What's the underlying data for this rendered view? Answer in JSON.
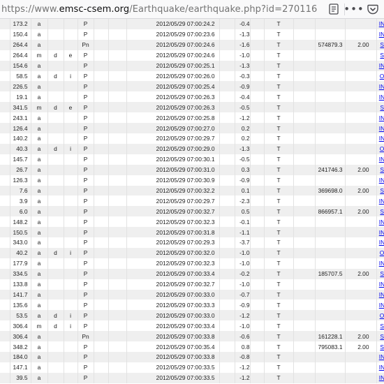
{
  "urlbar": {
    "url_prefix": "https://www.",
    "url_host": "emsc-csem.org",
    "url_path": "/Earthquake/earthquake.php?id=270116",
    "reader_icon": "reader-view-icon",
    "more_icon": "more-actions-icon",
    "pocket_icon": "pocket-icon",
    "more_glyph": "•••"
  },
  "table": {
    "rows": [
      {
        "dist": "173.2",
        "f1": "a",
        "f2": "",
        "f3": "",
        "phase": "P",
        "time": "2012/05/29 07:00:24.2",
        "res": "-0.4",
        "flag": "T",
        "amp": "",
        "period": "",
        "agency": "INGV"
      },
      {
        "dist": "150.4",
        "f1": "a",
        "f2": "",
        "f3": "",
        "phase": "P",
        "time": "2012/05/29 07:00:23.6",
        "res": "-1.3",
        "flag": "T",
        "amp": "",
        "period": "",
        "agency": "INGV"
      },
      {
        "dist": "264.4",
        "f1": "a",
        "f2": "",
        "f3": "",
        "phase": "Pn",
        "time": "2012/05/29 07:00:24.6",
        "res": "-1.6",
        "flag": "T",
        "amp": "574879.3",
        "period": "2.00",
        "agency": "SED"
      },
      {
        "dist": "264.4",
        "f1": "m",
        "f2": "d",
        "f3": "e",
        "phase": "P",
        "time": "2012/05/29 07:00:24.6",
        "res": "-1.0",
        "flag": "T",
        "amp": "",
        "period": "",
        "agency": "SED"
      },
      {
        "dist": "154.6",
        "f1": "a",
        "f2": "",
        "f3": "",
        "phase": "P",
        "time": "2012/05/29 07:00:25.1",
        "res": "-1.3",
        "flag": "T",
        "amp": "",
        "period": "",
        "agency": "INGV"
      },
      {
        "dist": "58.5",
        "f1": "a",
        "f2": "d",
        "f3": "i",
        "phase": "P",
        "time": "2012/05/29 07:00:26.0",
        "res": "-0.3",
        "flag": "T",
        "amp": "",
        "period": "",
        "agency": "OGS"
      },
      {
        "dist": "226.5",
        "f1": "a",
        "f2": "",
        "f3": "",
        "phase": "P",
        "time": "2012/05/29 07:00:25.4",
        "res": "-0.9",
        "flag": "T",
        "amp": "",
        "period": "",
        "agency": "INGV"
      },
      {
        "dist": "19.1",
        "f1": "a",
        "f2": "",
        "f3": "",
        "phase": "P",
        "time": "2012/05/29 07:00:26.3",
        "res": "-0.4",
        "flag": "T",
        "amp": "",
        "period": "",
        "agency": "INGV"
      },
      {
        "dist": "341.5",
        "f1": "m",
        "f2": "d",
        "f3": "e",
        "phase": "P",
        "time": "2012/05/29 07:00:26.3",
        "res": "-0.5",
        "flag": "T",
        "amp": "",
        "period": "",
        "agency": "SED"
      },
      {
        "dist": "243.1",
        "f1": "a",
        "f2": "",
        "f3": "",
        "phase": "P",
        "time": "2012/05/29 07:00:25.8",
        "res": "-1.2",
        "flag": "T",
        "amp": "",
        "period": "",
        "agency": "INGV"
      },
      {
        "dist": "126.4",
        "f1": "a",
        "f2": "",
        "f3": "",
        "phase": "P",
        "time": "2012/05/29 07:00:27.0",
        "res": "0.2",
        "flag": "T",
        "amp": "",
        "period": "",
        "agency": "INGV"
      },
      {
        "dist": "140.2",
        "f1": "a",
        "f2": "",
        "f3": "",
        "phase": "P",
        "time": "2012/05/29 07:00:29.7",
        "res": "0.2",
        "flag": "T",
        "amp": "",
        "period": "",
        "agency": "INGV"
      },
      {
        "dist": "40.3",
        "f1": "a",
        "f2": "d",
        "f3": "i",
        "phase": "P",
        "time": "2012/05/29 07:00:29.0",
        "res": "-1.3",
        "flag": "T",
        "amp": "",
        "period": "",
        "agency": "OGS"
      },
      {
        "dist": "145.7",
        "f1": "a",
        "f2": "",
        "f3": "",
        "phase": "P",
        "time": "2012/05/29 07:00:30.1",
        "res": "-0.5",
        "flag": "T",
        "amp": "",
        "period": "",
        "agency": "INGV"
      },
      {
        "dist": "26.7",
        "f1": "a",
        "f2": "",
        "f3": "",
        "phase": "P",
        "time": "2012/05/29 07:00:31.0",
        "res": "0.3",
        "flag": "T",
        "amp": "241746.3",
        "period": "2.00",
        "agency": "SED"
      },
      {
        "dist": "126.3",
        "f1": "a",
        "f2": "",
        "f3": "",
        "phase": "P",
        "time": "2012/05/29 07:00:30.9",
        "res": "-0.9",
        "flag": "T",
        "amp": "",
        "period": "",
        "agency": "INGV"
      },
      {
        "dist": "7.6",
        "f1": "a",
        "f2": "",
        "f3": "",
        "phase": "P",
        "time": "2012/05/29 07:00:32.2",
        "res": "0.1",
        "flag": "T",
        "amp": "369698.0",
        "period": "2.00",
        "agency": "SED"
      },
      {
        "dist": "3.9",
        "f1": "a",
        "f2": "",
        "f3": "",
        "phase": "P",
        "time": "2012/05/29 07:00:29.7",
        "res": "-2.3",
        "flag": "T",
        "amp": "",
        "period": "",
        "agency": "INGV"
      },
      {
        "dist": "6.0",
        "f1": "a",
        "f2": "",
        "f3": "",
        "phase": "P",
        "time": "2012/05/29 07:00:32.7",
        "res": "0.5",
        "flag": "T",
        "amp": "866957.1",
        "period": "2.00",
        "agency": "SED"
      },
      {
        "dist": "148.2",
        "f1": "a",
        "f2": "",
        "f3": "",
        "phase": "P",
        "time": "2012/05/29 07:00:32.3",
        "res": "-0.1",
        "flag": "T",
        "amp": "",
        "period": "",
        "agency": "INGV"
      },
      {
        "dist": "150.5",
        "f1": "a",
        "f2": "",
        "f3": "",
        "phase": "P",
        "time": "2012/05/29 07:00:31.8",
        "res": "-1.1",
        "flag": "T",
        "amp": "",
        "period": "",
        "agency": "INGV"
      },
      {
        "dist": "343.0",
        "f1": "a",
        "f2": "",
        "f3": "",
        "phase": "P",
        "time": "2012/05/29 07:00:29.3",
        "res": "-3.7",
        "flag": "T",
        "amp": "",
        "period": "",
        "agency": "INGV"
      },
      {
        "dist": "40.2",
        "f1": "a",
        "f2": "d",
        "f3": "i",
        "phase": "P",
        "time": "2012/05/29 07:00:32.0",
        "res": "-1.0",
        "flag": "T",
        "amp": "",
        "period": "",
        "agency": "OGS"
      },
      {
        "dist": "177.9",
        "f1": "a",
        "f2": "",
        "f3": "",
        "phase": "P",
        "time": "2012/05/29 07:00:32.3",
        "res": "-1.0",
        "flag": "T",
        "amp": "",
        "period": "",
        "agency": "INGV"
      },
      {
        "dist": "334.5",
        "f1": "a",
        "f2": "",
        "f3": "",
        "phase": "P",
        "time": "2012/05/29 07:00:33.4",
        "res": "-0.2",
        "flag": "T",
        "amp": "185707.5",
        "period": "2.00",
        "agency": "SED"
      },
      {
        "dist": "133.8",
        "f1": "a",
        "f2": "",
        "f3": "",
        "phase": "P",
        "time": "2012/05/29 07:00:32.7",
        "res": "-1.0",
        "flag": "T",
        "amp": "",
        "period": "",
        "agency": "INGV"
      },
      {
        "dist": "141.7",
        "f1": "a",
        "f2": "",
        "f3": "",
        "phase": "P",
        "time": "2012/05/29 07:00:33.0",
        "res": "-0.7",
        "flag": "T",
        "amp": "",
        "period": "",
        "agency": "INGV"
      },
      {
        "dist": "135.6",
        "f1": "a",
        "f2": "",
        "f3": "",
        "phase": "P",
        "time": "2012/05/29 07:00:33.3",
        "res": "-0.9",
        "flag": "T",
        "amp": "",
        "period": "",
        "agency": "INGV"
      },
      {
        "dist": "53.5",
        "f1": "a",
        "f2": "d",
        "f3": "i",
        "phase": "P",
        "time": "2012/05/29 07:00:33.0",
        "res": "-1.2",
        "flag": "T",
        "amp": "",
        "period": "",
        "agency": "OGS"
      },
      {
        "dist": "306.4",
        "f1": "m",
        "f2": "d",
        "f3": "i",
        "phase": "P",
        "time": "2012/05/29 07:00:33.4",
        "res": "-1.0",
        "flag": "T",
        "amp": "",
        "period": "",
        "agency": "SED"
      },
      {
        "dist": "306.4",
        "f1": "a",
        "f2": "",
        "f3": "",
        "phase": "Pn",
        "time": "2012/05/29 07:00:33.8",
        "res": "-0.6",
        "flag": "T",
        "amp": "161228.1",
        "period": "2.00",
        "agency": "SED"
      },
      {
        "dist": "348.2",
        "f1": "a",
        "f2": "",
        "f3": "",
        "phase": "P",
        "time": "2012/05/29 07:00:35.4",
        "res": "0.8",
        "flag": "T",
        "amp": "795083.1",
        "period": "2.00",
        "agency": "SED"
      },
      {
        "dist": "184.0",
        "f1": "a",
        "f2": "",
        "f3": "",
        "phase": "P",
        "time": "2012/05/29 07:00:33.8",
        "res": "-0.8",
        "flag": "T",
        "amp": "",
        "period": "",
        "agency": "INGV"
      },
      {
        "dist": "147.1",
        "f1": "a",
        "f2": "",
        "f3": "",
        "phase": "P",
        "time": "2012/05/29 07:00:33.5",
        "res": "-1.2",
        "flag": "T",
        "amp": "",
        "period": "",
        "agency": "INGV"
      },
      {
        "dist": "39.5",
        "f1": "a",
        "f2": "",
        "f3": "",
        "phase": "P",
        "time": "2012/05/29 07:00:33.5",
        "res": "-1.2",
        "flag": "T",
        "amp": "",
        "period": "",
        "agency": "INGV"
      }
    ]
  }
}
